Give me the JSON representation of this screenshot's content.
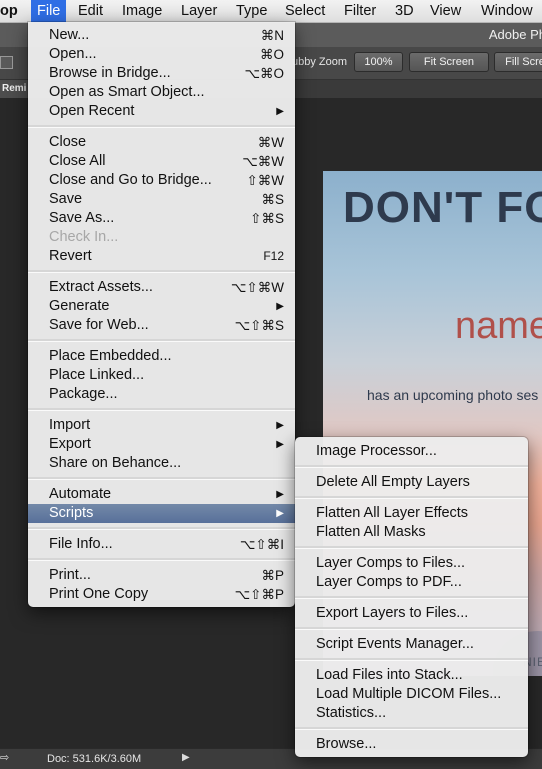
{
  "menubar": {
    "items": [
      "op",
      "File",
      "Edit",
      "Image",
      "Layer",
      "Type",
      "Select",
      "Filter",
      "3D",
      "View",
      "Window"
    ]
  },
  "titlebar": {
    "title": "Adobe Ph"
  },
  "optionsbar": {
    "scrubby_zoom_label": "ubby Zoom",
    "zoom_button": "100%",
    "fit_screen_button": "Fit Screen",
    "fill_screen_button": "Fill Scre"
  },
  "tab": {
    "label": "Remi"
  },
  "document": {
    "headline": "DON'T FO",
    "name_text": "name",
    "subtitle": "has an upcoming photo ses",
    "corner_text": "NIE"
  },
  "status": {
    "doc_size": "Doc: 531.6K/3.60M"
  },
  "file_menu": {
    "items": [
      {
        "label": "New...",
        "shortcut": "⌘N"
      },
      {
        "label": "Open...",
        "shortcut": "⌘O"
      },
      {
        "label": "Browse in Bridge...",
        "shortcut": "⌥⌘O"
      },
      {
        "label": "Open as Smart Object...",
        "shortcut": ""
      },
      {
        "label": "Open Recent",
        "shortcut": "",
        "submenu": true
      },
      {
        "label": "Close",
        "shortcut": "⌘W"
      },
      {
        "label": "Close All",
        "shortcut": "⌥⌘W"
      },
      {
        "label": "Close and Go to Bridge...",
        "shortcut": "⇧⌘W"
      },
      {
        "label": "Save",
        "shortcut": "⌘S"
      },
      {
        "label": "Save As...",
        "shortcut": "⇧⌘S"
      },
      {
        "label": "Check In...",
        "shortcut": "",
        "disabled": true
      },
      {
        "label": "Revert",
        "shortcut": "F12"
      },
      {
        "label": "Extract Assets...",
        "shortcut": "⌥⇧⌘W"
      },
      {
        "label": "Generate",
        "shortcut": "",
        "submenu": true
      },
      {
        "label": "Save for Web...",
        "shortcut": "⌥⇧⌘S"
      },
      {
        "label": "Place Embedded...",
        "shortcut": ""
      },
      {
        "label": "Place Linked...",
        "shortcut": ""
      },
      {
        "label": "Package...",
        "shortcut": ""
      },
      {
        "label": "Import",
        "shortcut": "",
        "submenu": true
      },
      {
        "label": "Export",
        "shortcut": "",
        "submenu": true
      },
      {
        "label": "Share on Behance...",
        "shortcut": ""
      },
      {
        "label": "Automate",
        "shortcut": "",
        "submenu": true
      },
      {
        "label": "Scripts",
        "shortcut": "",
        "submenu": true,
        "highlighted": true
      },
      {
        "label": "File Info...",
        "shortcut": "⌥⇧⌘I"
      },
      {
        "label": "Print...",
        "shortcut": "⌘P"
      },
      {
        "label": "Print One Copy",
        "shortcut": "⌥⇧⌘P"
      }
    ],
    "submenu_arrow": "▶"
  },
  "scripts_menu": {
    "items": [
      "Image Processor...",
      "Delete All Empty Layers",
      "Flatten All Layer Effects",
      "Flatten All Masks",
      "Layer Comps to Files...",
      "Layer Comps to PDF...",
      "Export Layers to Files...",
      "Script Events Manager...",
      "Load Files into Stack...",
      "Load Multiple DICOM Files...",
      "Statistics...",
      "Browse..."
    ]
  },
  "colors": {
    "menu_highlight": "#5f76a0",
    "menubar_active": "#2f6ee5",
    "workspace": "#282828"
  }
}
